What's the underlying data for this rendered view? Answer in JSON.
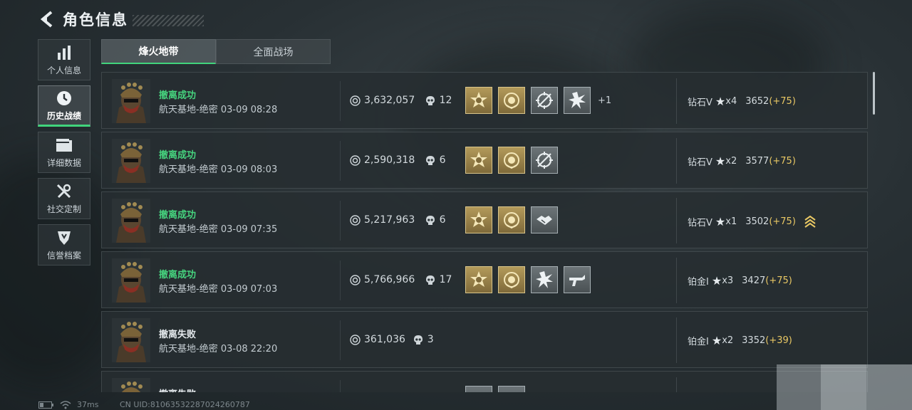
{
  "header": {
    "title": "角色信息"
  },
  "nav": [
    {
      "label": "个人信息",
      "icon": "bar-chart-icon"
    },
    {
      "label": "历史战绩",
      "icon": "clock-icon",
      "active": true
    },
    {
      "label": "详细数据",
      "icon": "folder-icon"
    },
    {
      "label": "社交定制",
      "icon": "tools-icon"
    },
    {
      "label": "信誉档案",
      "icon": "shield-icon"
    }
  ],
  "tabs": [
    {
      "label": "烽火地带",
      "active": true
    },
    {
      "label": "全面战场",
      "active": false
    }
  ],
  "matches": [
    {
      "status": "撤离成功",
      "result": "success",
      "location": "航天基地-绝密",
      "time": "03-09 08:28",
      "money": "3,632,057",
      "kills": "12",
      "medals": [
        "gold-sun",
        "gold-wreath",
        "silver-target",
        "silver-burst"
      ],
      "extra": "+1",
      "rank": "钻石V",
      "stars": "x4",
      "score": "3652",
      "delta": "(+75)"
    },
    {
      "status": "撤离成功",
      "result": "success",
      "location": "航天基地-绝密",
      "time": "03-09 08:03",
      "money": "2,590,318",
      "kills": "6",
      "medals": [
        "gold-sun",
        "gold-wreath",
        "silver-target"
      ],
      "extra": "",
      "rank": "钻石V",
      "stars": "x2",
      "score": "3577",
      "delta": "(+75)"
    },
    {
      "status": "撤离成功",
      "result": "success",
      "location": "航天基地-绝密",
      "time": "03-09 07:35",
      "money": "5,217,963",
      "kills": "6",
      "medals": [
        "gold-sun",
        "gold-wreath",
        "silver-handshake"
      ],
      "extra": "",
      "rank": "钻石V",
      "stars": "x1",
      "score": "3502",
      "delta": "(+75)",
      "promoted": true
    },
    {
      "status": "撤离成功",
      "result": "success",
      "location": "航天基地-绝密",
      "time": "03-09 07:03",
      "money": "5,766,966",
      "kills": "17",
      "medals": [
        "gold-sun",
        "gold-wreath",
        "silver-burst",
        "silver-gun"
      ],
      "extra": "",
      "rank": "铂金I",
      "stars": "x3",
      "score": "3427",
      "delta": "(+75)"
    },
    {
      "status": "撤离失败",
      "result": "fail",
      "location": "航天基地-绝密",
      "time": "03-08 22:20",
      "money": "361,036",
      "kills": "3",
      "medals": [],
      "extra": "",
      "rank": "铂金I",
      "stars": "x2",
      "score": "3352",
      "delta": "(+39)"
    },
    {
      "status": "撤离失败",
      "result": "fail",
      "location": "",
      "time": "",
      "money": "",
      "kills": "",
      "medals": [
        "silver-plain",
        "silver-plain"
      ],
      "extra": "",
      "rank": "",
      "stars": "",
      "score": "",
      "delta": ""
    }
  ],
  "statusbar": {
    "ping": "37ms",
    "uid": "CN UID:8106353228702426078​7"
  },
  "colors": {
    "accent_green": "#41d47c",
    "gold_delta": "#e9c864",
    "success": "#46d37e"
  }
}
